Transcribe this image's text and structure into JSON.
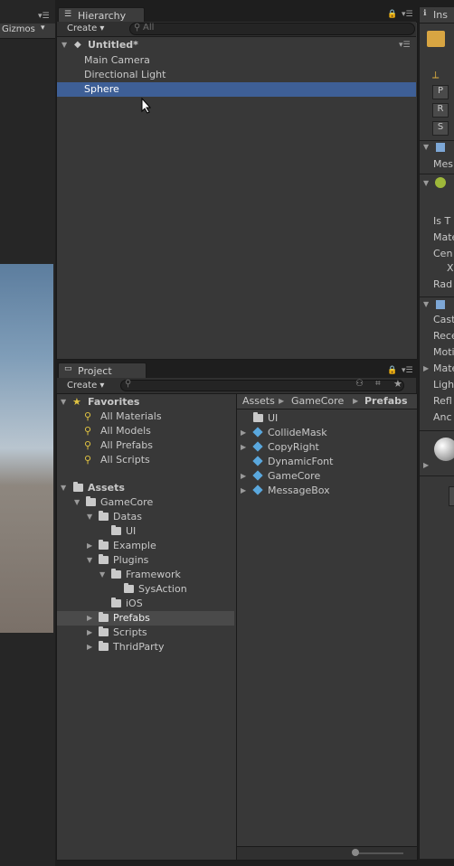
{
  "scene": {
    "gizmos_label": "Gizmos",
    "gizmos_arrow": "▾"
  },
  "hierarchy": {
    "tab_label": "Hierarchy",
    "create_label": "Create",
    "search_placeholder": "All",
    "scene_name": "Untitled*",
    "items": [
      {
        "label": "Main Camera"
      },
      {
        "label": "Directional Light"
      },
      {
        "label": "Sphere",
        "selected": true
      }
    ]
  },
  "project": {
    "tab_label": "Project",
    "create_label": "Create",
    "favorites": {
      "label": "Favorites",
      "items": [
        "All Materials",
        "All Models",
        "All Prefabs",
        "All Scripts"
      ]
    },
    "assets_label": "Assets",
    "tree": [
      {
        "label": "GameCore",
        "depth": 1,
        "expanded": true
      },
      {
        "label": "Datas",
        "depth": 2,
        "expanded": true
      },
      {
        "label": "UI",
        "depth": 3
      },
      {
        "label": "Example",
        "depth": 2,
        "collapsed": true
      },
      {
        "label": "Plugins",
        "depth": 2,
        "expanded": true
      },
      {
        "label": "Framework",
        "depth": 3,
        "expanded": true
      },
      {
        "label": "SysAction",
        "depth": 4
      },
      {
        "label": "iOS",
        "depth": 3
      },
      {
        "label": "Prefabs",
        "depth": 2,
        "collapsed": true,
        "selected": true
      },
      {
        "label": "Scripts",
        "depth": 2,
        "collapsed": true
      },
      {
        "label": "ThridParty",
        "depth": 2,
        "collapsed": true
      }
    ],
    "breadcrumb": [
      "Assets",
      "GameCore",
      "Prefabs"
    ],
    "files": [
      {
        "label": "UI",
        "kind": "folder"
      },
      {
        "label": "CollideMask",
        "kind": "prefab",
        "expandable": true
      },
      {
        "label": "CopyRight",
        "kind": "prefab",
        "expandable": true
      },
      {
        "label": "DynamicFont",
        "kind": "prefab"
      },
      {
        "label": "GameCore",
        "kind": "prefab",
        "expandable": true
      },
      {
        "label": "MessageBox",
        "kind": "prefab",
        "expandable": true
      }
    ]
  },
  "inspector": {
    "tab_label": "Ins",
    "labels": [
      "Mes",
      "Is T",
      "Mate",
      "Cen",
      "X",
      "Rad",
      "Cast",
      "Rece",
      "Moti",
      "Mate",
      "Ligh",
      "Refl",
      "Anc"
    ],
    "transform_buttons": [
      "P",
      "R",
      "S"
    ]
  },
  "colors": {
    "selection": "#3e5f96",
    "prefab_icon": "#5aa8de",
    "favorite_star": "#e1c442"
  }
}
